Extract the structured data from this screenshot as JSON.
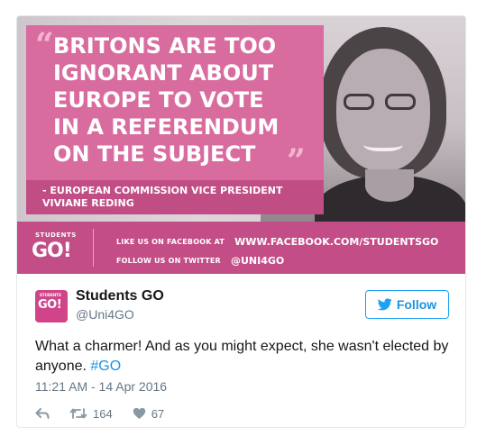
{
  "media": {
    "quote_lines": "BRITONS ARE TOO\nIGNORANT ABOUT\nEUROPE TO VOTE\nIN A REFERENDUM\nON THE SUBJECT",
    "attribution": "- EUROPEAN COMMISSION VICE PRESIDENT\nVIVIANE REDING",
    "logo_top": "STUDENTS",
    "logo_main": "GO!",
    "facebook_prefix": "LIKE US ON FACEBOOK AT",
    "facebook_url": "WWW.FACEBOOK.COM/STUDENTSGO",
    "twitter_prefix": "FOLLOW US ON TWITTER",
    "twitter_handle": "@UNI4GO"
  },
  "tweet": {
    "display_name": "Students GO",
    "handle": "@Uni4GO",
    "follow_label": "Follow",
    "text": "What a charmer! And as you might expect, she wasn't elected by anyone.",
    "hashtag": "#GO",
    "timestamp": "11:21 AM - 14 Apr 2016",
    "retweet_count": "164",
    "like_count": "67",
    "avatar_top": "STUDENTS",
    "avatar_main": "GO!"
  },
  "colors": {
    "brand_pink": "#c34d86",
    "twitter_blue": "#1da1f2"
  },
  "icons": {
    "reply": "reply-icon",
    "retweet": "retweet-icon",
    "like": "heart-icon",
    "follow": "twitter-bird-icon"
  }
}
